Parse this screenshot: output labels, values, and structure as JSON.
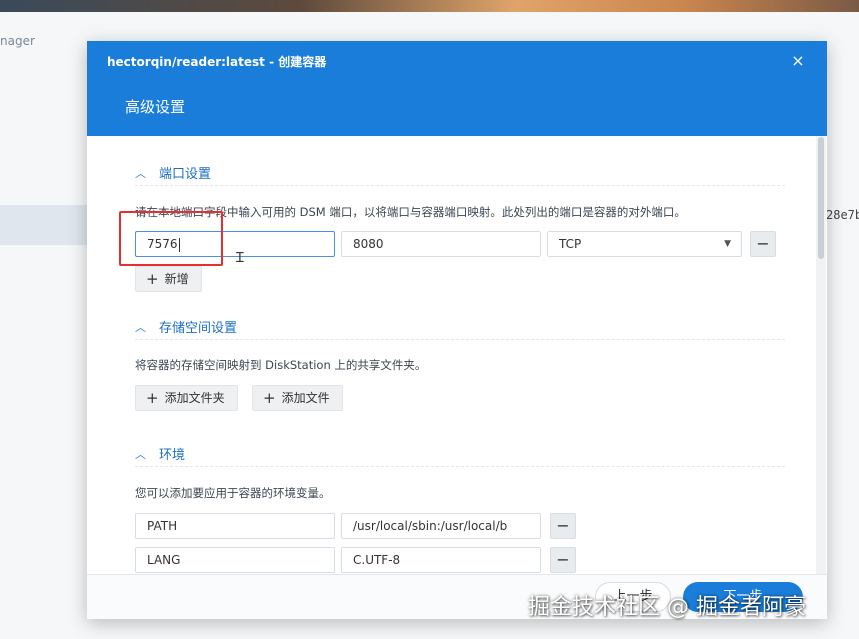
{
  "background": {
    "sidebar_label": "nager",
    "right_text": "28e7b"
  },
  "dialog": {
    "title": "hectorqin/reader:latest - 创建容器",
    "close_icon": "×",
    "subtitle": "高级设置"
  },
  "ports": {
    "section_title": "端口设置",
    "description": "请在本地端口字段中输入可用的 DSM 端口，以将端口与容器端口映射。此处列出的端口是容器的对外端口。",
    "local_port": "7576",
    "container_port": "8080",
    "protocol": "TCP",
    "add_label": "新增"
  },
  "storage": {
    "section_title": "存储空间设置",
    "description": "将容器的存储空间映射到 DiskStation 上的共享文件夹。",
    "add_folder_label": "添加文件夹",
    "add_file_label": "添加文件"
  },
  "environment": {
    "section_title": "环境",
    "description": "您可以添加要应用于容器的环境变量。",
    "variables": [
      {
        "name": "PATH",
        "value": "/usr/local/sbin:/usr/local/b"
      },
      {
        "name": "LANG",
        "value": "C.UTF-8"
      }
    ]
  },
  "footer": {
    "cancel_label": "上一步",
    "next_label": "下一步"
  },
  "watermark": "掘金技术社区 @ 掘金者阿豪",
  "colors": {
    "accent": "#1a7dd9",
    "highlight": "#e53030"
  }
}
